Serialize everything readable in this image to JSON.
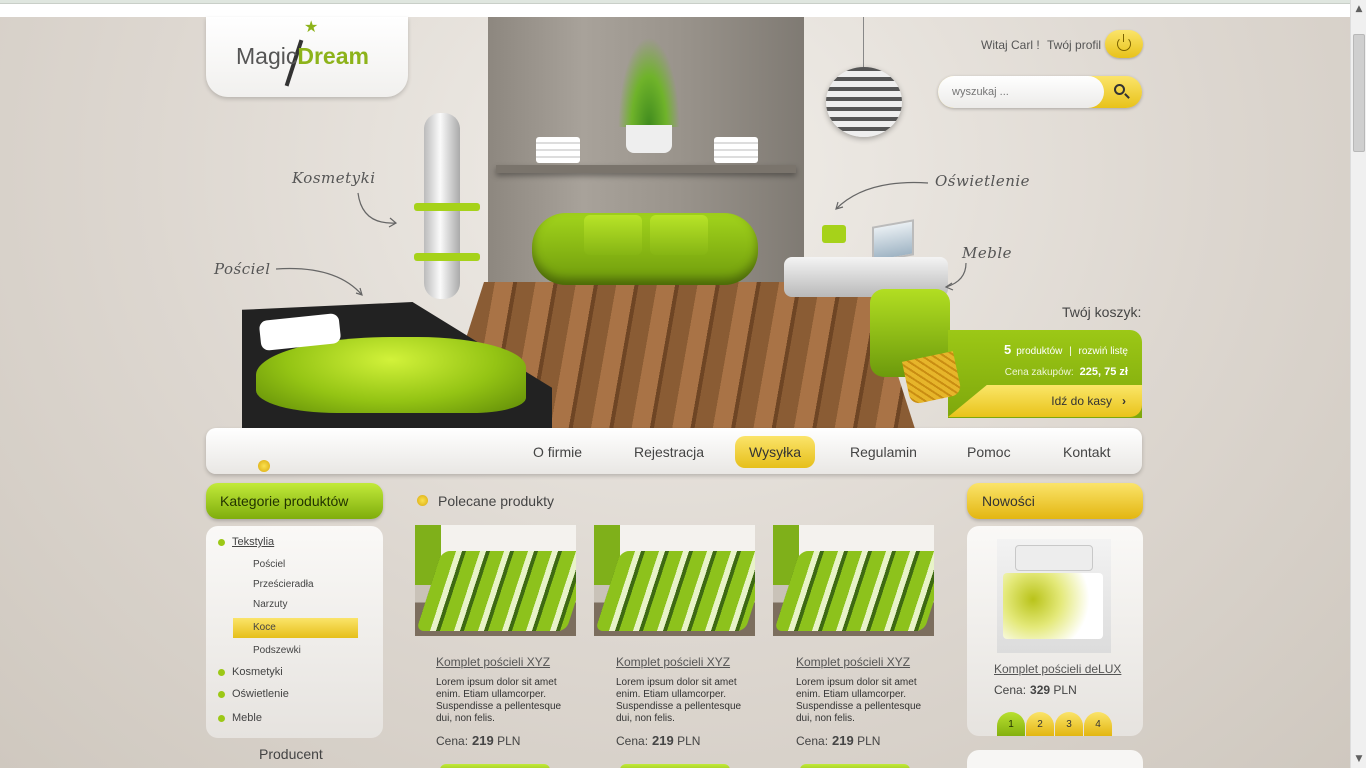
{
  "brand": {
    "logo_part1": "Magic",
    "logo_part2": "Dream"
  },
  "header": {
    "welcome": "Witaj Carl !",
    "profile_link": "Twój profil",
    "search_placeholder": "wyszukaj ...",
    "icons": [
      "power-icon",
      "search-icon"
    ]
  },
  "hero": {
    "labels": {
      "kosmetyki": "Kosmetyki",
      "posciel": "Pościel",
      "oswietlenie": "Oświetlenie",
      "meble": "Meble"
    }
  },
  "cart": {
    "title": "Twój koszyk:",
    "count": "5",
    "count_text": "produktów",
    "separator": "|",
    "expand_link": "rozwiń listę",
    "total_label": "Cena zakupów:",
    "total_value": "225, 75 zł",
    "checkout_label": "Idź do kasy"
  },
  "nav": {
    "items": [
      {
        "label": "O firmie",
        "active": false
      },
      {
        "label": "Rejestracja",
        "active": false
      },
      {
        "label": "Wysyłka",
        "active": true
      },
      {
        "label": "Regulamin",
        "active": false
      },
      {
        "label": "Pomoc",
        "active": false
      },
      {
        "label": "Kontakt",
        "active": false
      }
    ]
  },
  "categories": {
    "title": "Kategorie produktów",
    "items": [
      {
        "label": "Tekstylia",
        "subitems": [
          "Pościel",
          "Prześcieradła",
          "Narzuty",
          "Koce",
          "Podszewki"
        ],
        "active_sub": "Koce"
      },
      {
        "label": "Kosmetyki"
      },
      {
        "label": "Oświetlenie"
      },
      {
        "label": "Meble"
      }
    ],
    "producer_title": "Producent"
  },
  "featured": {
    "title": "Polecane produkty",
    "products": [
      {
        "name": "Komplet pościeli XYZ",
        "desc": "Lorem ipsum dolor sit amet enim. Etiam ullamcorper. Suspendisse a pellentesque dui, non felis.",
        "price_label": "Cena:",
        "price": "219",
        "currency": "PLN"
      },
      {
        "name": "Komplet pościeli XYZ",
        "desc": "Lorem ipsum dolor sit amet enim. Etiam ullamcorper. Suspendisse a pellentesque dui, non felis.",
        "price_label": "Cena:",
        "price": "219",
        "currency": "PLN"
      },
      {
        "name": "Komplet pościeli XYZ",
        "desc": "Lorem ipsum dolor sit amet enim. Etiam ullamcorper. Suspendisse a pellentesque dui, non felis.",
        "price_label": "Cena:",
        "price": "219",
        "currency": "PLN"
      }
    ]
  },
  "news": {
    "title": "Nowości",
    "product": {
      "name": "Komplet pościeli deLUX",
      "price_label": "Cena:",
      "price": "329",
      "currency": "PLN"
    },
    "pages": [
      "1",
      "2",
      "3",
      "4"
    ],
    "active_page": "1"
  },
  "colors": {
    "accent_green": "#8db31a",
    "accent_yellow": "#e8c21a",
    "text": "#444444"
  }
}
